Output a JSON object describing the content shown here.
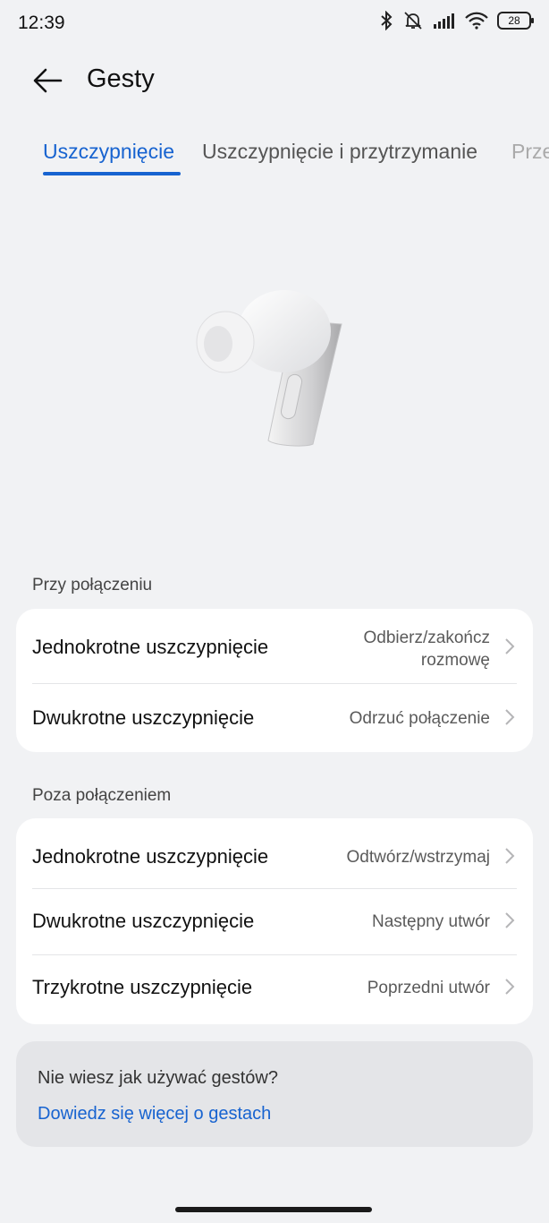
{
  "status_bar": {
    "time": "12:39",
    "battery": "28",
    "icons": [
      "bluetooth-icon",
      "muted-bell-icon",
      "signal-icon",
      "wifi-icon",
      "battery-icon"
    ]
  },
  "header": {
    "title": "Gesty"
  },
  "tabs": [
    {
      "label": "Uszczypnięcie",
      "active": true
    },
    {
      "label": "Uszczypnięcie i przytrzymanie",
      "active": false
    },
    {
      "label": "Prze",
      "active": false
    }
  ],
  "sections": [
    {
      "label": "Przy połączeniu",
      "rows": [
        {
          "label": "Jednokrotne uszczypnięcie",
          "value_line1": "Odbierz/zakończ",
          "value_line2": "rozmowę"
        },
        {
          "label": "Dwukrotne uszczypnięcie",
          "value": "Odrzuć połączenie"
        }
      ]
    },
    {
      "label": "Poza połączeniem",
      "rows": [
        {
          "label": "Jednokrotne uszczypnięcie",
          "value": "Odtwórz/wstrzymaj"
        },
        {
          "label": "Dwukrotne uszczypnięcie",
          "value": "Następny utwór"
        },
        {
          "label": "Trzykrotne uszczypnięcie",
          "value": "Poprzedni utwór"
        }
      ]
    }
  ],
  "help": {
    "question": "Nie wiesz jak używać gestów?",
    "link": "Dowiedz się więcej o gestach"
  },
  "colors": {
    "accent": "#1763d0",
    "background": "#f1f2f4",
    "card": "#ffffff"
  }
}
